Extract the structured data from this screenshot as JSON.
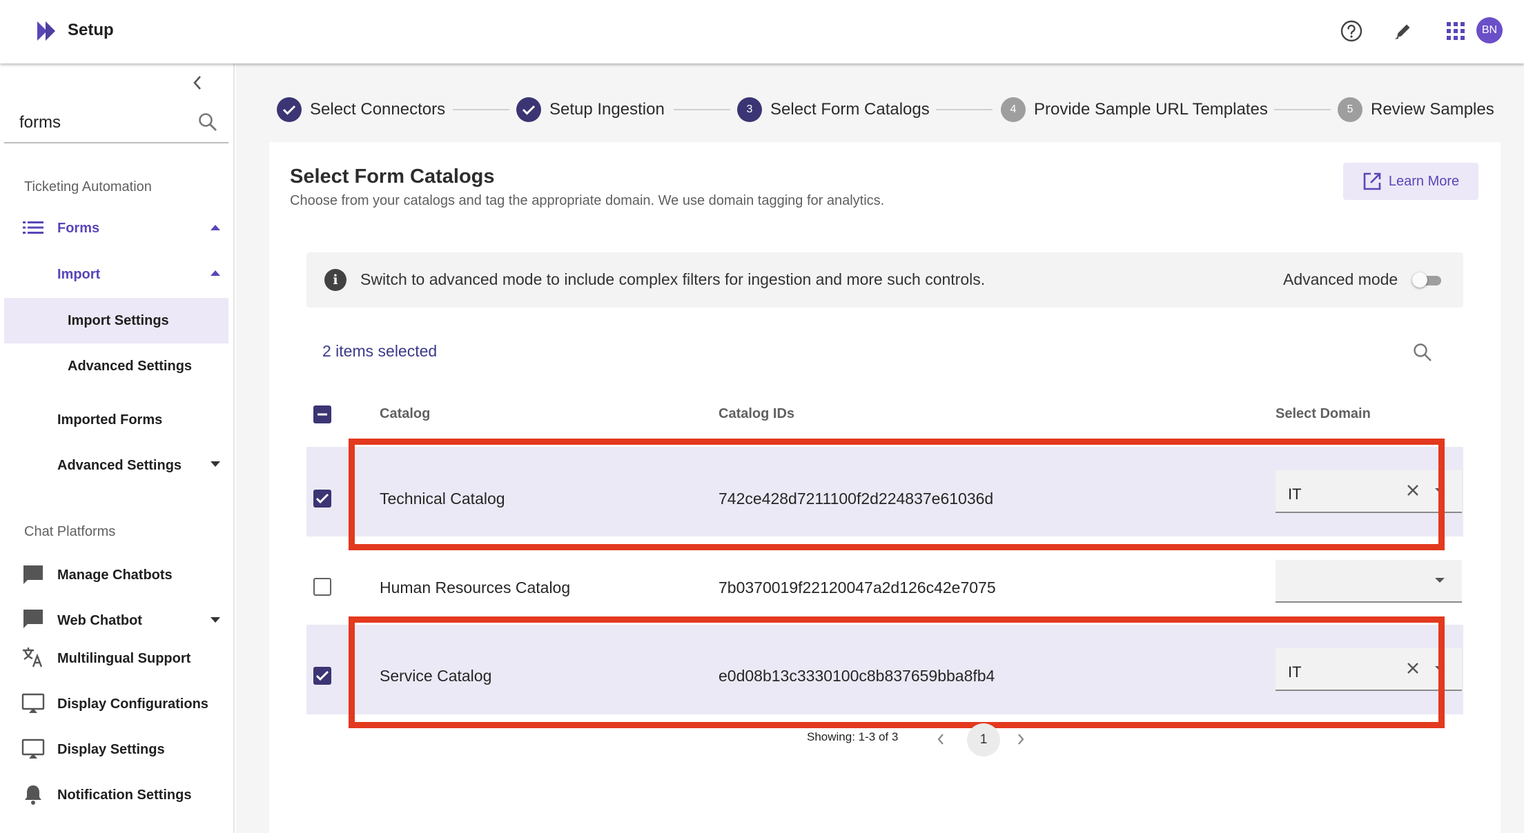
{
  "header": {
    "title": "Setup",
    "icons": [
      "help-circle-icon",
      "pencil-icon",
      "apps-grid-icon"
    ],
    "avatar_initials": "BN",
    "accent": "#6b4fc8"
  },
  "sidebar": {
    "search": {
      "value": "forms",
      "placeholder": ""
    },
    "sections": {
      "ticketing": "Ticketing Automation",
      "chat": "Chat Platforms"
    },
    "items": {
      "forms": "Forms",
      "import": "Import",
      "import_settings": "Import Settings",
      "import_advanced_settings": "Advanced Settings",
      "imported_forms": "Imported Forms",
      "advanced_settings": "Advanced Settings",
      "manage_chatbots": "Manage Chatbots",
      "web_chatbot": "Web Chatbot",
      "multilingual": "Multilingual Support",
      "display_configurations": "Display Configurations",
      "display_settings": "Display Settings",
      "notification_settings": "Notification Settings"
    }
  },
  "stepper": {
    "steps": [
      {
        "label": "Select Connectors",
        "state": "done"
      },
      {
        "label": "Setup Ingestion",
        "state": "done"
      },
      {
        "number": "3",
        "label": "Select Form Catalogs",
        "state": "active"
      },
      {
        "number": "4",
        "label": "Provide Sample URL Templates",
        "state": "pending"
      },
      {
        "number": "5",
        "label": "Review Samples",
        "state": "pending"
      }
    ]
  },
  "card": {
    "title": "Select Form Catalogs",
    "subtitle": "Choose from your catalogs and tag the appropriate domain. We use domain tagging for analytics.",
    "learn_more": "Learn More",
    "info_text": "Switch to advanced mode to include complex filters for ingestion and more such controls.",
    "advanced_mode_label": "Advanced mode",
    "advanced_mode_on": false,
    "selected_count": "2 items selected"
  },
  "table": {
    "columns": {
      "catalog": "Catalog",
      "ids": "Catalog IDs",
      "domain": "Select Domain"
    },
    "rows": [
      {
        "selected": true,
        "catalog": "Technical Catalog",
        "id": "742ce428d7211100f2d224837e61036d",
        "domain": "IT"
      },
      {
        "selected": false,
        "catalog": "Human Resources Catalog",
        "id": "7b0370019f22120047a2d126c42e7075",
        "domain": ""
      },
      {
        "selected": true,
        "catalog": "Service Catalog",
        "id": "e0d08b13c3330100c8b837659bba8fb4",
        "domain": "IT"
      }
    ],
    "highlight_color": "#e3391e"
  },
  "pagination": {
    "text": "Showing: 1-3 of 3",
    "current_page": "1"
  }
}
